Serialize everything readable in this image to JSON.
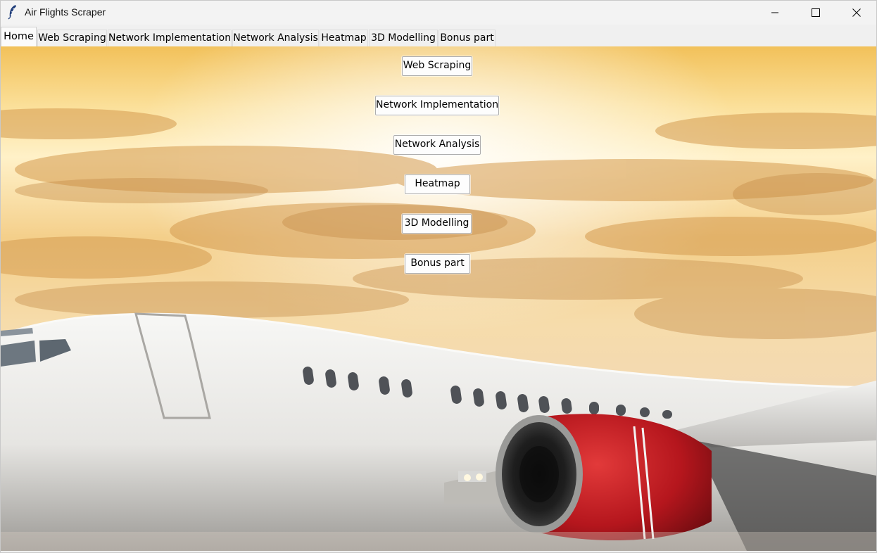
{
  "window": {
    "title": "Air Flights Scraper",
    "icon": "feather-icon",
    "controls": [
      "minimize-icon",
      "maximize-icon",
      "close-icon"
    ]
  },
  "tabs": [
    {
      "label": "Home",
      "active": true
    },
    {
      "label": "Web Scraping",
      "active": false
    },
    {
      "label": "Network Implementation",
      "active": false
    },
    {
      "label": "Network Analysis",
      "active": false
    },
    {
      "label": "Heatmap",
      "active": false
    },
    {
      "label": "3D Modelling",
      "active": false
    },
    {
      "label": "Bonus part",
      "active": false
    }
  ],
  "home": {
    "buttons": [
      "Web Scraping",
      "Network Implementation",
      "Network Analysis",
      "Heatmap",
      "3D Modelling",
      "Bonus part"
    ]
  },
  "colors": {
    "sky_top": "#f6d170",
    "sky_mid": "#fde6a8",
    "cloud": "#d9a863",
    "fuselage": "#ececec",
    "engine_red": "#c81f25"
  }
}
